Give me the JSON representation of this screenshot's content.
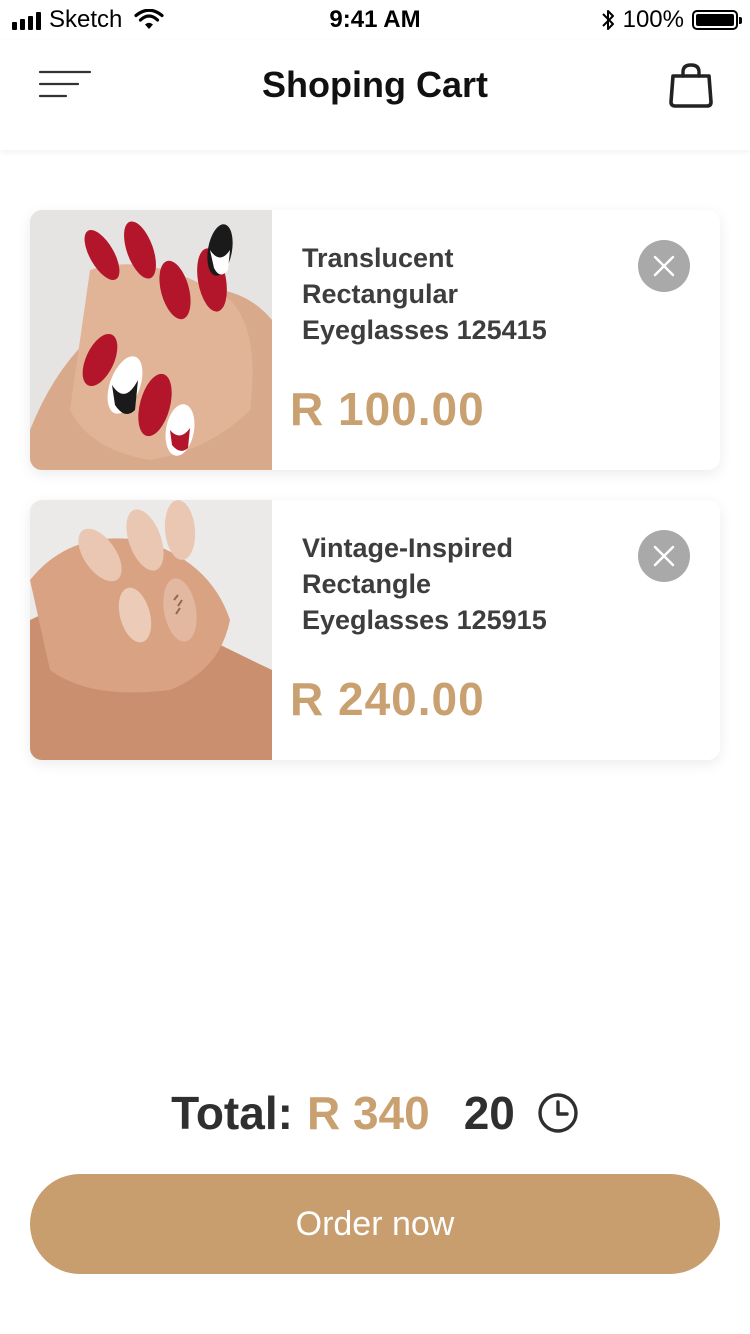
{
  "status_bar": {
    "carrier": "Sketch",
    "time": "9:41 AM",
    "battery_percent": "100%",
    "icons": [
      "signal-icon",
      "wifi-icon",
      "bluetooth-icon",
      "battery-icon"
    ]
  },
  "header": {
    "title": "Shoping Cart",
    "left_icon": "menu-icon",
    "right_icon": "shopping-bag-icon"
  },
  "cart": {
    "items": [
      {
        "name": "Translucent Rectangular Eyeglasses 125415",
        "price": "R 100.00",
        "image": "red-black-white-drip-nails-photo"
      },
      {
        "name": "Vintage-Inspired Rectangle Eyeglasses 125915",
        "price": "R 240.00",
        "image": "nude-almond-nails-photo"
      }
    ]
  },
  "summary": {
    "total_label": "Total:",
    "total_value": "R 340",
    "count": "20",
    "count_icon": "clock-icon"
  },
  "actions": {
    "order_label": "Order now"
  },
  "colors": {
    "accent": "#c89e6f",
    "price": "#c9a06f",
    "remove_button": "#a9a9a9",
    "text": "#2f2f2f"
  }
}
